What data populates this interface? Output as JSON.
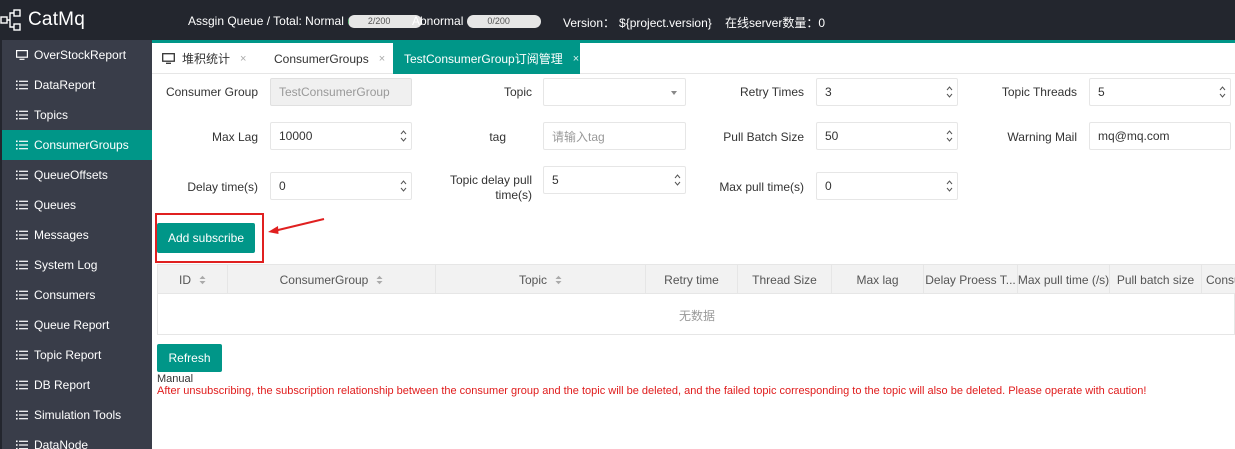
{
  "header": {
    "app_name": "CatMq",
    "assign_label": "Assgin Queue / Total: Normal",
    "normal_progress_text": "2/200",
    "normal_progress_fraction": 0.01,
    "abnormal_label": "Abnormal",
    "abnormal_progress_text": "0/200",
    "abnormal_progress_fraction": 0,
    "version_label": "Version：",
    "version_value": "${project.version}",
    "server_count_label": "在线server数量：",
    "server_count_value": "0"
  },
  "sidebar": {
    "items": [
      {
        "label": "OverStockReport",
        "icon": "monitor-icon"
      },
      {
        "label": "DataReport",
        "icon": "list-icon"
      },
      {
        "label": "Topics",
        "icon": "list-icon"
      },
      {
        "label": "ConsumerGroups",
        "icon": "list-icon",
        "active": true
      },
      {
        "label": "QueueOffsets",
        "icon": "list-icon"
      },
      {
        "label": "Queues",
        "icon": "list-icon"
      },
      {
        "label": "Messages",
        "icon": "list-icon"
      },
      {
        "label": "System Log",
        "icon": "list-icon"
      },
      {
        "label": "Consumers",
        "icon": "list-icon"
      },
      {
        "label": "Queue Report",
        "icon": "list-icon"
      },
      {
        "label": "Topic Report",
        "icon": "list-icon"
      },
      {
        "label": "DB Report",
        "icon": "list-icon"
      },
      {
        "label": "Simulation Tools",
        "icon": "list-icon"
      },
      {
        "label": "DataNode",
        "icon": "list-icon"
      }
    ]
  },
  "tabs": [
    {
      "label": "堆积统计",
      "icon": "monitor-icon"
    },
    {
      "label": "ConsumerGroups"
    },
    {
      "label": "TestConsumerGroup订阅管理",
      "active": true
    }
  ],
  "tab_close_glyph": "×",
  "form": {
    "consumer_group_label": "Consumer Group",
    "consumer_group_value": "TestConsumerGroup",
    "topic_label": "Topic",
    "topic_value": "",
    "retry_times_label": "Retry Times",
    "retry_times_value": "3",
    "topic_threads_label": "Topic Threads",
    "topic_threads_value": "5",
    "max_lag_label": "Max Lag",
    "max_lag_value": "10000",
    "tag_label": "tag",
    "tag_placeholder": "请输入tag",
    "pull_batch_size_label": "Pull Batch Size",
    "pull_batch_size_value": "50",
    "warning_mail_label": "Warning Mail",
    "warning_mail_value": "mq@mq.com",
    "delay_time_label": "Delay time(s)",
    "delay_time_value": "0",
    "topic_delay_pull_label_1": "Topic delay pull",
    "topic_delay_pull_label_2": "time(s)",
    "topic_delay_pull_value": "5",
    "max_pull_time_label": "Max pull time(s)",
    "max_pull_time_value": "0"
  },
  "add_subscribe_label": "Add subscribe",
  "table": {
    "columns": [
      "ID",
      "ConsumerGroup",
      "Topic",
      "Retry time",
      "Thread Size",
      "Max lag",
      "Delay Proess T...",
      "Max pull time (/s)",
      "Pull batch size",
      "Consu"
    ],
    "empty_text": "无数据"
  },
  "refresh_label": "Refresh",
  "manual_label": "Manual",
  "warning_text": "After unsubscribing, the subscription relationship between the consumer group and the topic will be deleted, and the failed topic corresponding to the topic will also be deleted. Please operate with caution!",
  "colors": {
    "accent": "#009688",
    "header_bg": "#23262e",
    "sidebar_bg": "#393d49",
    "warning": "#e01c1c",
    "annotation": "#e02020"
  }
}
